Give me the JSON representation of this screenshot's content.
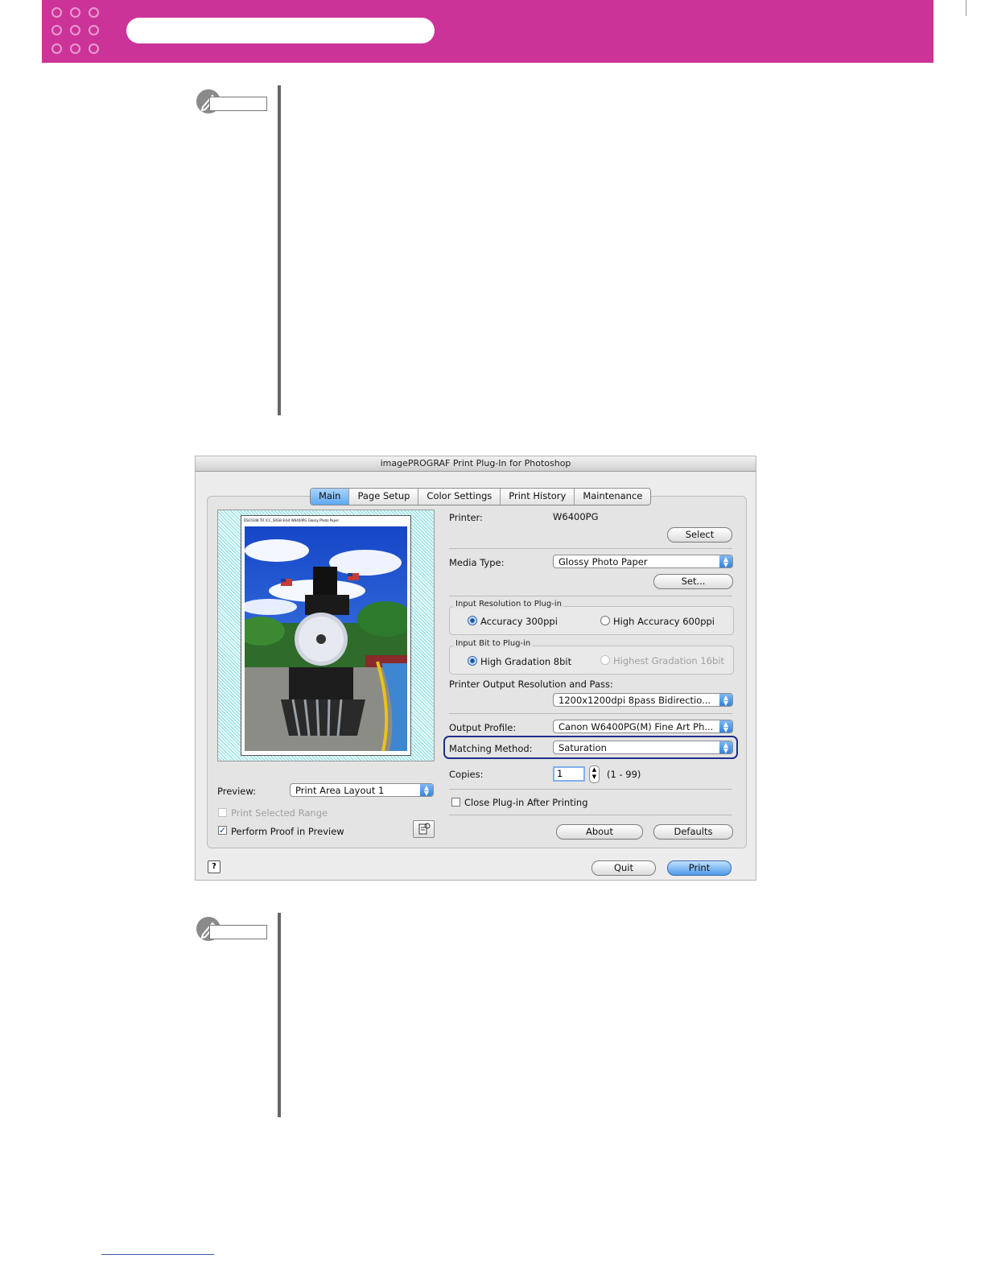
{
  "dialog": {
    "title": "imagePROGRAF Print Plug-In for Photoshop",
    "tabs": [
      "Main",
      "Page Setup",
      "Color Settings",
      "Print History",
      "Maintenance"
    ],
    "active_tab": "Main",
    "printer_label": "Printer:",
    "printer_value": "W6400PG",
    "select_button": "Select",
    "media_type_label": "Media Type:",
    "media_type_value": "Glossy Photo Paper",
    "set_button": "Set...",
    "input_resolution": {
      "title": "Input Resolution to Plug-in",
      "option1": "Accuracy 300ppi",
      "option2": "High Accuracy 600ppi",
      "selected": "Accuracy 300ppi"
    },
    "input_bit": {
      "title": "Input Bit to Plug-in",
      "option1": "High Gradation 8bit",
      "option2": "Highest Gradation 16bit",
      "selected": "High Gradation 8bit"
    },
    "output_resolution_label": "Printer Output Resolution and Pass:",
    "output_resolution_value": "1200x1200dpi 8pass Bidirectio...",
    "output_profile_label": "Output Profile:",
    "output_profile_value": "Canon W6400PG(M) Fine Art Ph...",
    "matching_method_label": "Matching Method:",
    "matching_method_value": "Saturation",
    "copies_label": "Copies:",
    "copies_value": "1",
    "copies_range": "(1 - 99)",
    "close_plugin_label": "Close Plug-in After Printing",
    "about_button": "About",
    "defaults_button": "Defaults",
    "preview_label": "Preview:",
    "preview_value": "Print Area Layout 1",
    "print_selected_range_label": "Print Selected Range",
    "perform_proof_label": "Perform Proof in Preview",
    "perform_proof_checked": true,
    "help_icon": "?",
    "quit_button": "Quit",
    "print_button": "Print",
    "preview_header_text": "DSC0348.TIF  ICC_SRGB  8-bit  W6400PG  Glossy Photo Paper",
    "accent_color": "#1f2e8a"
  }
}
